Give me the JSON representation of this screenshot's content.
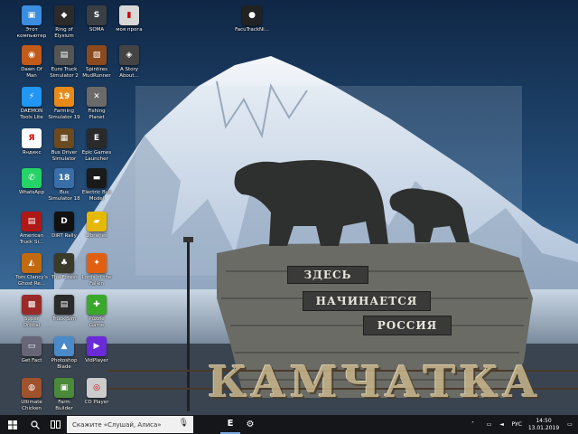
{
  "desktop_icons": [
    {
      "label": "Этот\nкомпьютер",
      "icon": "computer-icon",
      "color": "#3b8de0",
      "glyph": "▣"
    },
    {
      "label": "Ring of\nElysium",
      "icon": "game-icon",
      "color": "#2b2b2b",
      "glyph": "◆"
    },
    {
      "label": "SOMA",
      "icon": "game-icon",
      "color": "#3a3f44",
      "glyph": "S"
    },
    {
      "label": "моя прога",
      "icon": "file-icon",
      "color": "#d8d8d8",
      "glyph": "▮"
    },
    {
      "label": "FacuTrackNi...",
      "icon": "app-icon",
      "color": "#222",
      "glyph": "●"
    },
    {
      "label": "Dawn Of\nMan",
      "icon": "game-icon",
      "color": "#c25a1a",
      "glyph": "◉"
    },
    {
      "label": "Euro Truck\nSimulator 2",
      "icon": "game-icon",
      "color": "#555",
      "glyph": "▤"
    },
    {
      "label": "Spintires\nMudRunner",
      "icon": "game-icon",
      "color": "#8a4a1e",
      "glyph": "▧"
    },
    {
      "label": "A Story\nAbout...",
      "icon": "game-icon",
      "color": "#444",
      "glyph": "◈"
    },
    {
      "label": "DAEMON\nTools Lite",
      "icon": "app-icon",
      "color": "#2196f3",
      "glyph": "⚡"
    },
    {
      "label": "Farming\nSimulator 19",
      "icon": "game-icon",
      "color": "#e88a1a",
      "glyph": "19"
    },
    {
      "label": "Fishing\nPlanet",
      "icon": "game-icon",
      "color": "#6a6a6a",
      "glyph": "✕"
    },
    {
      "label": "Яндекс",
      "icon": "browser-icon",
      "color": "#ffffff",
      "glyph": "Я"
    },
    {
      "label": "Bus Driver\nSimulator",
      "icon": "game-icon",
      "color": "#6b4a20",
      "glyph": "▦"
    },
    {
      "label": "Epic Games\nLauncher",
      "icon": "app-icon",
      "color": "#2a2a2a",
      "glyph": "E"
    },
    {
      "label": "WhatsApp",
      "icon": "chat-icon",
      "color": "#25d366",
      "glyph": "✆"
    },
    {
      "label": "Bus\nSimulator 18",
      "icon": "game-icon",
      "color": "#3a6ea8",
      "glyph": "18"
    },
    {
      "label": "Electric Bus\nModel",
      "icon": "game-icon",
      "color": "#1a1a1a",
      "glyph": "▬"
    },
    {
      "label": "American\nTruck Si...",
      "icon": "game-icon",
      "color": "#b01818",
      "glyph": "▤"
    },
    {
      "label": "DiRT Rally",
      "icon": "game-icon",
      "color": "#111",
      "glyph": "D"
    },
    {
      "label": "Libraries",
      "icon": "folder-icon",
      "color": "#e6b800",
      "glyph": "▰"
    },
    {
      "label": "Tom Clancy's\nGhost Re...",
      "icon": "game-icon",
      "color": "#c26a10",
      "glyph": "◭"
    },
    {
      "label": "The Forest",
      "icon": "game-icon",
      "color": "#3a3a2a",
      "glyph": "♣"
    },
    {
      "label": "Lords of the\nFallen",
      "icon": "game-icon",
      "color": "#e06010",
      "glyph": "✦"
    },
    {
      "label": "Super\nOrbital",
      "icon": "game-icon",
      "color": "#9a2a2a",
      "glyph": "▩"
    },
    {
      "label": "Truck Sim",
      "icon": "game-icon",
      "color": "#2a2a2a",
      "glyph": "▤"
    },
    {
      "label": "Puzzle\nGame",
      "icon": "game-icon",
      "color": "#3aa82a",
      "glyph": "✚"
    },
    {
      "label": "Get Fact",
      "icon": "app-icon",
      "color": "#667",
      "glyph": "▭"
    },
    {
      "label": "Photoshop\nBlade",
      "icon": "app-icon",
      "color": "#4a8ac8",
      "glyph": "▲"
    },
    {
      "label": "VidPlayer",
      "icon": "app-icon",
      "color": "#6a2ad8",
      "glyph": "▶"
    },
    {
      "label": "Ultimate\nChicken",
      "icon": "game-icon",
      "color": "#a0522d",
      "glyph": "◍"
    },
    {
      "label": "Farm\nBuilder",
      "icon": "game-icon",
      "color": "#4a8a3a",
      "glyph": "▣"
    },
    {
      "label": "CD Player",
      "icon": "app-icon",
      "color": "#cccccc",
      "glyph": "◎"
    }
  ],
  "wallpaper": {
    "sign_top": "ЗДЕСЬ",
    "sign_mid": "НАЧИНАЕТСЯ",
    "sign_bottom": "РОССИЯ",
    "banner": "КАМЧАТКА"
  },
  "taskbar": {
    "start_icon": "windows-icon",
    "search_placeholder": "Скажите «Слушай, Алиса»",
    "language": "РУС",
    "time": "14:50",
    "date": "13.01.2019"
  }
}
